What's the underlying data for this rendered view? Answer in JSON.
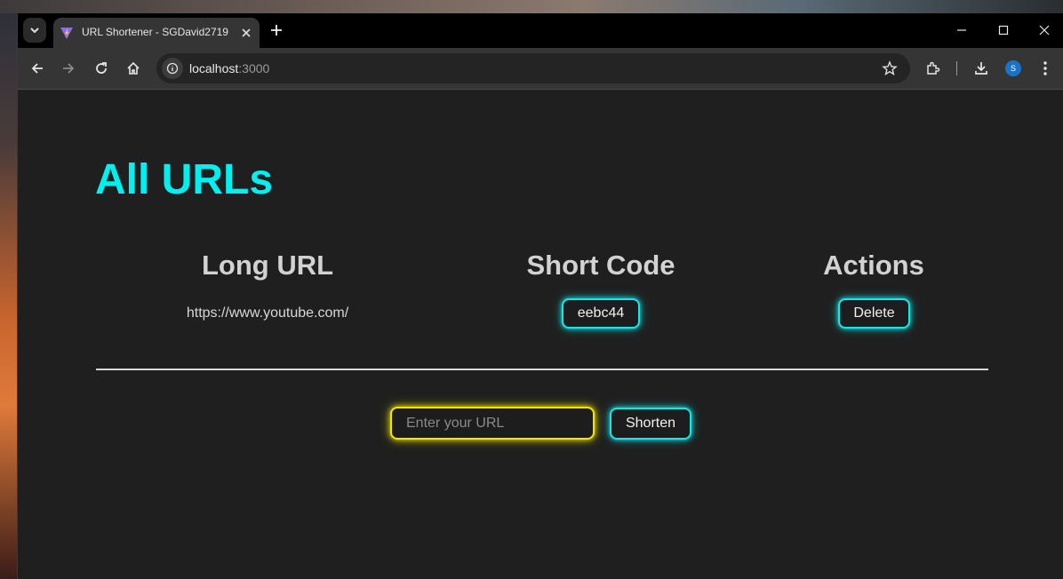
{
  "browser": {
    "tab_title": "URL Shortener - SGDavid2719",
    "url_host": "localhost",
    "url_port": ":3000",
    "profile_initial": "S"
  },
  "page": {
    "title": "All URLs",
    "columns": [
      "Long URL",
      "Short Code",
      "Actions"
    ],
    "rows": [
      {
        "long_url": "https://www.youtube.com/",
        "short_code": "eebc44",
        "action": "Delete"
      }
    ],
    "input_placeholder": "Enter your URL",
    "shorten_label": "Shorten"
  },
  "colors": {
    "title": "#00f0f0",
    "neon_cyan": "#17e6e6",
    "neon_yellow": "#f2e600",
    "page_bg": "#1f1f1f"
  },
  "icons": [
    "tab-search-icon",
    "vite-favicon-icon",
    "close-icon",
    "new-tab-icon",
    "minimize-icon",
    "maximize-icon",
    "window-close-icon",
    "back-icon",
    "forward-icon",
    "reload-icon",
    "home-icon",
    "info-icon",
    "star-icon",
    "extensions-icon",
    "download-icon",
    "menu-icon"
  ]
}
